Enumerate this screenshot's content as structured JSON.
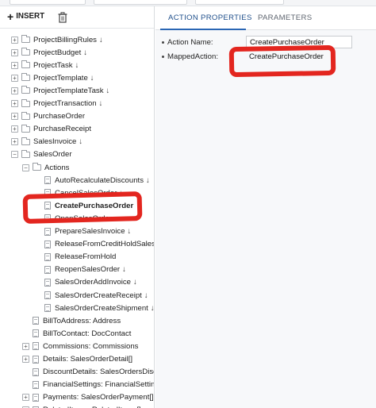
{
  "toolbar": {
    "insert_label": "INSERT"
  },
  "tree": [
    {
      "label": "ProjectBillingRules",
      "level": 0,
      "type": "folder",
      "toggle": "+",
      "arrow": true
    },
    {
      "label": "ProjectBudget",
      "level": 0,
      "type": "folder",
      "toggle": "+",
      "arrow": true
    },
    {
      "label": "ProjectTask",
      "level": 0,
      "type": "folder",
      "toggle": "+",
      "arrow": true
    },
    {
      "label": "ProjectTemplate",
      "level": 0,
      "type": "folder",
      "toggle": "+",
      "arrow": true
    },
    {
      "label": "ProjectTemplateTask",
      "level": 0,
      "type": "folder",
      "toggle": "+",
      "arrow": true
    },
    {
      "label": "ProjectTransaction",
      "level": 0,
      "type": "folder",
      "toggle": "+",
      "arrow": true
    },
    {
      "label": "PurchaseOrder",
      "level": 0,
      "type": "folder",
      "toggle": "+",
      "arrow": false
    },
    {
      "label": "PurchaseReceipt",
      "level": 0,
      "type": "folder",
      "toggle": "+",
      "arrow": false
    },
    {
      "label": "SalesInvoice",
      "level": 0,
      "type": "folder",
      "toggle": "+",
      "arrow": true
    },
    {
      "label": "SalesOrder",
      "level": 0,
      "type": "folder",
      "toggle": "−",
      "arrow": false
    },
    {
      "label": "Actions",
      "level": 1,
      "type": "folder",
      "toggle": "−",
      "arrow": false
    },
    {
      "label": "AutoRecalculateDiscounts",
      "level": 2,
      "type": "doc",
      "arrow": true
    },
    {
      "label": "CancelSalesOrder",
      "level": 2,
      "type": "doc",
      "arrow": true
    },
    {
      "label": "CreatePurchaseOrder",
      "level": 2,
      "type": "doc",
      "arrow": false,
      "bold": true
    },
    {
      "label": "OpenSalesOrder",
      "level": 2,
      "type": "doc",
      "arrow": false
    },
    {
      "label": "PrepareSalesInvoice",
      "level": 2,
      "type": "doc",
      "arrow": true
    },
    {
      "label": "ReleaseFromCreditHoldSalesOrder",
      "level": 2,
      "type": "doc",
      "arrow": false
    },
    {
      "label": "ReleaseFromHold",
      "level": 2,
      "type": "doc",
      "arrow": false
    },
    {
      "label": "ReopenSalesOrder",
      "level": 2,
      "type": "doc",
      "arrow": true
    },
    {
      "label": "SalesOrderAddInvoice",
      "level": 2,
      "type": "doc",
      "arrow": true
    },
    {
      "label": "SalesOrderCreateReceipt",
      "level": 2,
      "type": "doc",
      "arrow": true
    },
    {
      "label": "SalesOrderCreateShipment",
      "level": 2,
      "type": "doc",
      "arrow": true
    },
    {
      "label": "BillToAddress: Address",
      "level": 1,
      "type": "doc",
      "arrow": false
    },
    {
      "label": "BillToContact: DocContact",
      "level": 1,
      "type": "doc",
      "arrow": false
    },
    {
      "label": "Commissions: Commissions",
      "level": 1,
      "type": "doc",
      "toggle": "+",
      "arrow": false
    },
    {
      "label": "Details: SalesOrderDetail[]",
      "level": 1,
      "type": "doc",
      "toggle": "+",
      "arrow": false
    },
    {
      "label": "DiscountDetails: SalesOrdersDiscountDetails[]",
      "level": 1,
      "type": "doc",
      "arrow": false
    },
    {
      "label": "FinancialSettings: FinancialSettings",
      "level": 1,
      "type": "doc",
      "arrow": false
    },
    {
      "label": "Payments: SalesOrderPayment[]",
      "level": 1,
      "type": "doc",
      "toggle": "+",
      "arrow": false
    },
    {
      "label": "RelatedItems: RelatedItems[]",
      "level": 1,
      "type": "doc",
      "toggle": "+",
      "arrow": false
    }
  ],
  "tabs": {
    "active": "ACTION PROPERTIES",
    "inactive": "PARAMETERS"
  },
  "properties": {
    "action_name_label": "Action Name:",
    "action_name_value": "CreatePurchaseOrder",
    "mapped_action_label": "MappedAction:",
    "mapped_action_value": "CreatePurchaseOrder"
  },
  "colors": {
    "annotation": "#e3261f",
    "tab_accent": "#2a66b4"
  }
}
